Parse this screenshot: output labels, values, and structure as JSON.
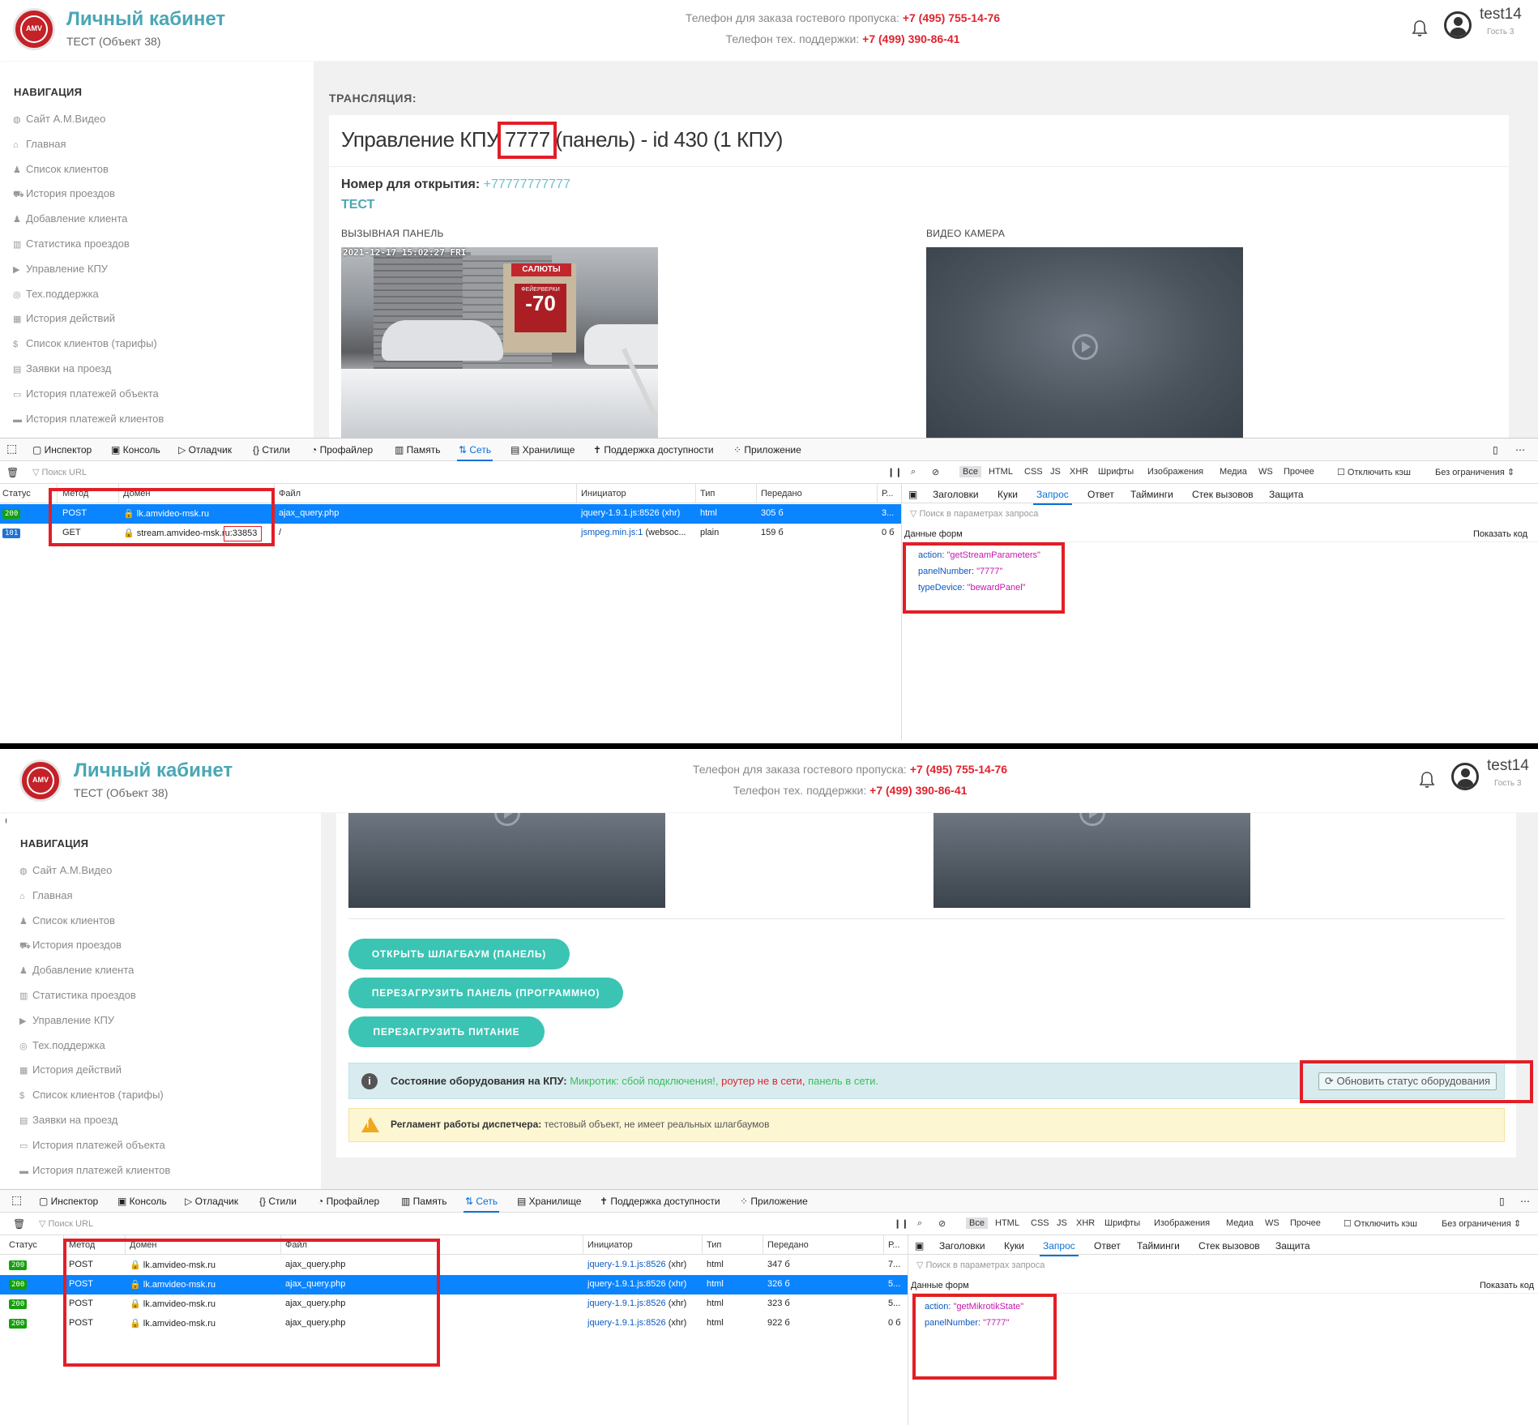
{
  "header": {
    "logo_text": "AMV",
    "title": "Личный кабинет",
    "subtitle": "ТЕСТ (Объект 38)",
    "phone1_label": "Телефон для заказа гостевого пропуска:",
    "phone1": "+7 (495) 755-14-76",
    "phone2_label": "Телефон тех. поддержки:",
    "phone2": "+7 (499) 390-86-41",
    "username": "test14",
    "role": "Гость 3"
  },
  "sidebar": {
    "title": "НАВИГАЦИЯ",
    "items": [
      {
        "icon": "globe-icon",
        "glyph": "◍",
        "label": "Сайт А.М.Видео"
      },
      {
        "icon": "home-icon",
        "glyph": "⌂",
        "label": "Главная"
      },
      {
        "icon": "user-icon",
        "glyph": "♟",
        "label": "Список клиентов"
      },
      {
        "icon": "car-icon",
        "glyph": "⛟",
        "label": "История проездов"
      },
      {
        "icon": "user-plus-icon",
        "glyph": "♟",
        "label": "Добавление клиента"
      },
      {
        "icon": "bar-chart-icon",
        "glyph": "▥",
        "label": "Статистика проездов"
      },
      {
        "icon": "video-icon",
        "glyph": "▶",
        "label": "Управление КПУ"
      },
      {
        "icon": "support-icon",
        "glyph": "◎",
        "label": "Тех.поддержка"
      },
      {
        "icon": "calendar-icon",
        "glyph": "▦",
        "label": "История действий"
      },
      {
        "icon": "dollar-icon",
        "glyph": "$",
        "label": "Список клиентов (тарифы)"
      },
      {
        "icon": "book-icon",
        "glyph": "▤",
        "label": "Заявки на проезд"
      },
      {
        "icon": "credit-card-icon",
        "glyph": "▭",
        "label": "История платежей объекта"
      },
      {
        "icon": "credit-card-icon",
        "glyph": "▬",
        "label": "История платежей клиентов"
      }
    ]
  },
  "stream": {
    "section_label": "ТРАНСЛЯЦИЯ:",
    "title_pre": "Управление КПУ ",
    "title_highlight": "7777",
    "title_post": " (панель) - id 430 (1 КПУ)",
    "number_label": "Номер для открытия:",
    "number_value": "+77777777777",
    "test_label": "ТЕСТ",
    "panel_label": "ВЫЗЫВНАЯ ПАНЕЛЬ",
    "camera_label": "ВИДЕО КАМЕРА",
    "panel_overlay": "2021-12-17 15:02:27 FRI",
    "shop_sign": "САЛЮТЫ",
    "sale_label": "ФЕЙЕРВЕРКИ",
    "sale_value": "-70"
  },
  "controls": {
    "open_button": "ОТКРЫТЬ ШЛАГБАУМ (ПАНЕЛЬ)",
    "reboot_panel_button": "ПЕРЕЗАГРУЗИТЬ ПАНЕЛЬ (ПРОГРАММНО)",
    "reboot_power_button": "ПЕРЕЗАГРУЗИТЬ ПИТАНИЕ",
    "status_label": "Состояние оборудования на КПУ:",
    "status_p1": "Микротик: сбой подключения!,",
    "status_p2": "роутер не в сети,",
    "status_p3": "панель в сети.",
    "refresh_button": "Обновить статус оборудования",
    "rules_label": "Регламент работы диспетчера:",
    "rules_text": "тестовый объект, не имеет реальных шлагбаумов"
  },
  "devtools": {
    "tabs": [
      "Инспектор",
      "Консоль",
      "Отладчик",
      "Стили",
      "Профайлер",
      "Память",
      "Сеть",
      "Хранилище",
      "Поддержка доступности",
      "Приложение"
    ],
    "filter_placeholder": "Поиск URL",
    "filters": [
      "Все",
      "HTML",
      "CSS",
      "JS",
      "XHR",
      "Шрифты",
      "Изображения",
      "Медиа",
      "WS",
      "Прочее"
    ],
    "disable_cache": "Отключить кэш",
    "throttle": "Без ограничения ⇕",
    "columns": [
      "Статус",
      "Метод",
      "Домен",
      "Файл",
      "Инициатор",
      "Тип",
      "Передано",
      "Р..."
    ],
    "detail_tabs": [
      "Заголовки",
      "Куки",
      "Запрос",
      "Ответ",
      "Тайминги",
      "Стек вызовов",
      "Защита"
    ],
    "params_search": "Поиск в параметрах запроса",
    "form_data_label": "Данные форм",
    "show_code": "Показать код",
    "top_rows": [
      {
        "status": "200",
        "method": "POST",
        "domain": "lk.amvideo-msk.ru",
        "file": "ajax_query.php",
        "initiator": "jquery-1.9.1.js:8526",
        "init_type": "(xhr)",
        "type": "html",
        "transferred": "305 б",
        "r": "3..."
      },
      {
        "status": "101",
        "method": "GET",
        "domain": "stream.amvideo-msk.ru",
        "port": ":33853",
        "file": "/",
        "initiator": "jsmpeg.min.js:1",
        "init_type": "(websoc...",
        "type": "plain",
        "transferred": "159 б",
        "r": "0 б"
      }
    ],
    "top_params": [
      {
        "key": "action:",
        "value": "\"getStreamParameters\""
      },
      {
        "key": "panelNumber:",
        "value": "\"7777\""
      },
      {
        "key": "typeDevice:",
        "value": "\"bewardPanel\""
      }
    ],
    "bottom_rows": [
      {
        "status": "200",
        "method": "POST",
        "domain": "lk.amvideo-msk.ru",
        "file": "ajax_query.php",
        "initiator": "jquery-1.9.1.js:8526",
        "init_type": "(xhr)",
        "type": "html",
        "transferred": "347 б",
        "r": "7..."
      },
      {
        "status": "200",
        "method": "POST",
        "domain": "lk.amvideo-msk.ru",
        "file": "ajax_query.php",
        "initiator": "jquery-1.9.1.js:8526",
        "init_type": "(xhr)",
        "type": "html",
        "transferred": "326 б",
        "r": "5..."
      },
      {
        "status": "200",
        "method": "POST",
        "domain": "lk.amvideo-msk.ru",
        "file": "ajax_query.php",
        "initiator": "jquery-1.9.1.js:8526",
        "init_type": "(xhr)",
        "type": "html",
        "transferred": "323 б",
        "r": "5..."
      },
      {
        "status": "200",
        "method": "POST",
        "domain": "lk.amvideo-msk.ru",
        "file": "ajax_query.php",
        "initiator": "jquery-1.9.1.js:8526",
        "init_type": "(xhr)",
        "type": "html",
        "transferred": "922 б",
        "r": "0 б"
      }
    ],
    "bottom_params": [
      {
        "key": "action:",
        "value": "\"getMikrotikState\""
      },
      {
        "key": "panelNumber:",
        "value": "\"7777\""
      }
    ]
  },
  "colors": {
    "accent": "#4aa7b5",
    "phone": "#e0232e",
    "teal_button": "#3bc4b4",
    "highlight_red": "#e21e27",
    "selected_row": "#0a84ff"
  }
}
